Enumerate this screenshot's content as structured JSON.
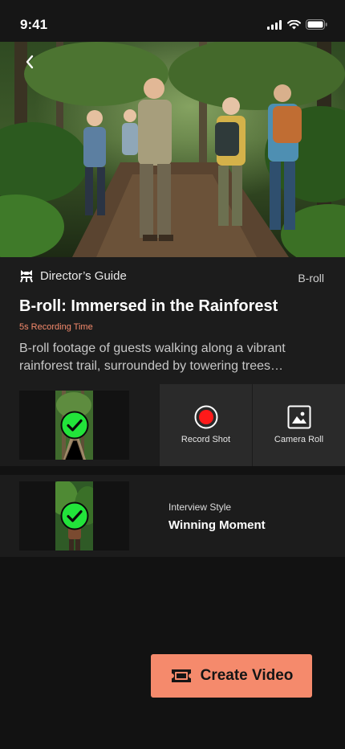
{
  "status_bar": {
    "time": "9:41",
    "icons": [
      "cellular-signal-icon",
      "wifi-icon",
      "battery-icon"
    ]
  },
  "hero": {
    "image_alt": "Group of hikers walking along a rainforest trail",
    "back_icon": "chevron-left-icon"
  },
  "guide": {
    "icon": "clapperboard-icon",
    "label": "Director’s Guide",
    "type": "B-roll",
    "title": "B-roll: Immersed in the Rainforest",
    "recording_time": "5s Recording Time",
    "description": "B-roll footage of guests walking along a vibrant rainforest trail, surrounded by towering trees…"
  },
  "shots": [
    {
      "thumb_icon": "check-circle-icon",
      "actions": [
        {
          "label": "Record Shot",
          "icon": "record-icon"
        },
        {
          "label": "Camera Roll",
          "icon": "image-icon"
        }
      ]
    },
    {
      "thumb_icon": "check-circle-icon",
      "style_label": "Interview Style",
      "style_title": "Winning Moment"
    }
  ],
  "create_button": {
    "label": "Create Video",
    "icon": "ticket-icon"
  },
  "colors": {
    "accent": "#f58a6c",
    "check_green": "#22e43a",
    "record_red": "#ff1a1a",
    "background": "#121212",
    "card": "#1c1c1c"
  }
}
